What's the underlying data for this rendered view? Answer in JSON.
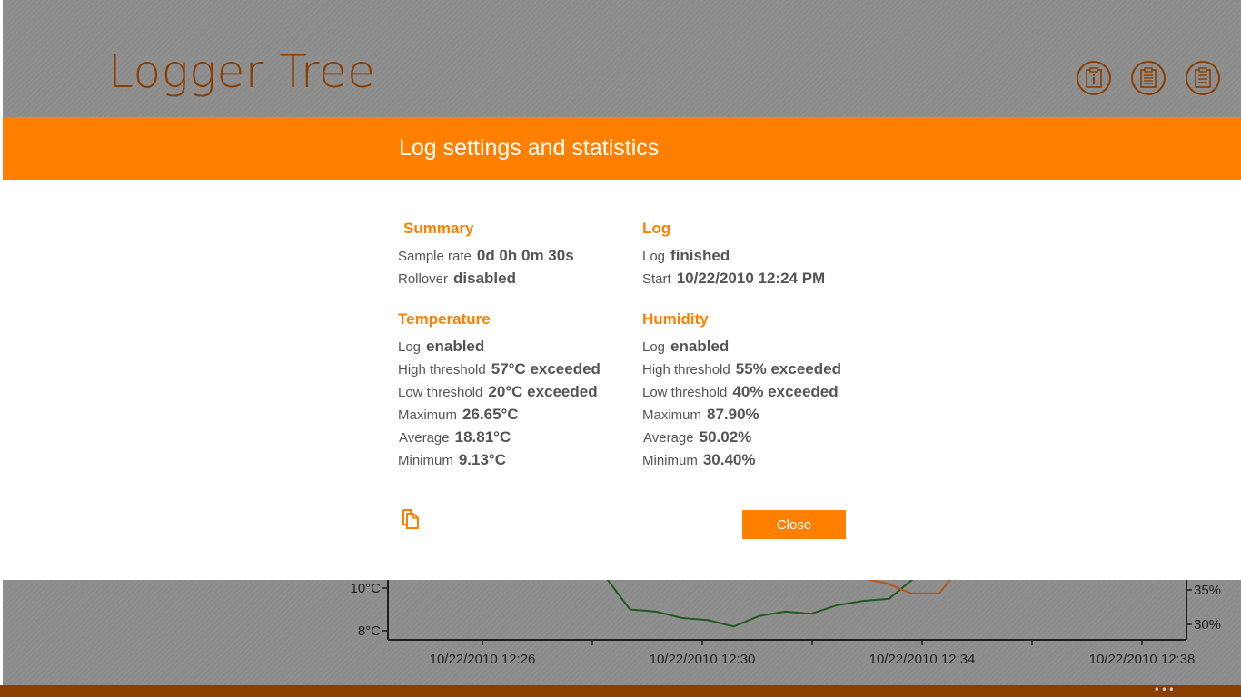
{
  "app": {
    "title": "Logger Tree"
  },
  "toolbar": {
    "icons": [
      "info-icon",
      "clipboard-icon",
      "clipboard-list-icon"
    ],
    "accent": "#8a3f00"
  },
  "chart": {
    "y_left_ticks": [
      "10°C",
      "8°C"
    ],
    "y_right_ticks": [
      "35%",
      "30%"
    ],
    "x_ticks": [
      "10/22/2010 12:26",
      "10/22/2010 12:30",
      "10/22/2010 12:34",
      "10/22/2010 12:38"
    ],
    "colors": {
      "temperature": "#1f5a1f",
      "humidity": "#b0581a"
    }
  },
  "chart_data": {
    "type": "line",
    "xlabel": "",
    "ylabel": "",
    "y_visible_range": [
      8,
      11
    ],
    "series": [
      {
        "color": "#1f5a1f",
        "axis": "left",
        "values": [
          10.6,
          9.0,
          8.9,
          8.6,
          8.5,
          8.2,
          8.7,
          8.9,
          8.8,
          9.2,
          9.4,
          9.5,
          10.5
        ]
      },
      {
        "color": "#b0581a",
        "axis": "right",
        "values": [
          36.5,
          36.0,
          34.5,
          34.5,
          34.5,
          36.5
        ]
      }
    ]
  },
  "dialog": {
    "title": "Log settings and statistics",
    "accent": "#ff8000",
    "summary": {
      "heading": "Summary",
      "sample_rate_label": "Sample rate",
      "sample_rate_value": "0d 0h 0m 30s",
      "rollover_label": "Rollover",
      "rollover_value": "disabled"
    },
    "log": {
      "heading": "Log",
      "log_label": "Log",
      "log_value": "finished",
      "start_label": "Start",
      "start_value": "10/22/2010 12:24 PM"
    },
    "temperature": {
      "heading": "Temperature",
      "log_label": "Log",
      "log_value": "enabled",
      "high_label": "High threshold",
      "high_value": "57°C exceeded",
      "low_label": "Low threshold",
      "low_value": "20°C exceeded",
      "max_label": "Maximum",
      "max_value": "26.65°C",
      "avg_label": "Average",
      "avg_value": "18.81°C",
      "min_label": "Minimum",
      "min_value": "9.13°C"
    },
    "humidity": {
      "heading": "Humidity",
      "log_label": "Log",
      "log_value": "enabled",
      "high_label": "High threshold",
      "high_value": "55% exceeded",
      "low_label": "Low threshold",
      "low_value": "40% exceeded",
      "max_label": "Maximum",
      "max_value": "87.90%",
      "avg_label": "Average",
      "avg_value": "50.02%",
      "min_label": "Minimum",
      "min_value": "30.40%"
    },
    "copy_icon": "copy-icon",
    "close_label": "Close"
  },
  "appbar": {
    "more_label": "•••"
  }
}
